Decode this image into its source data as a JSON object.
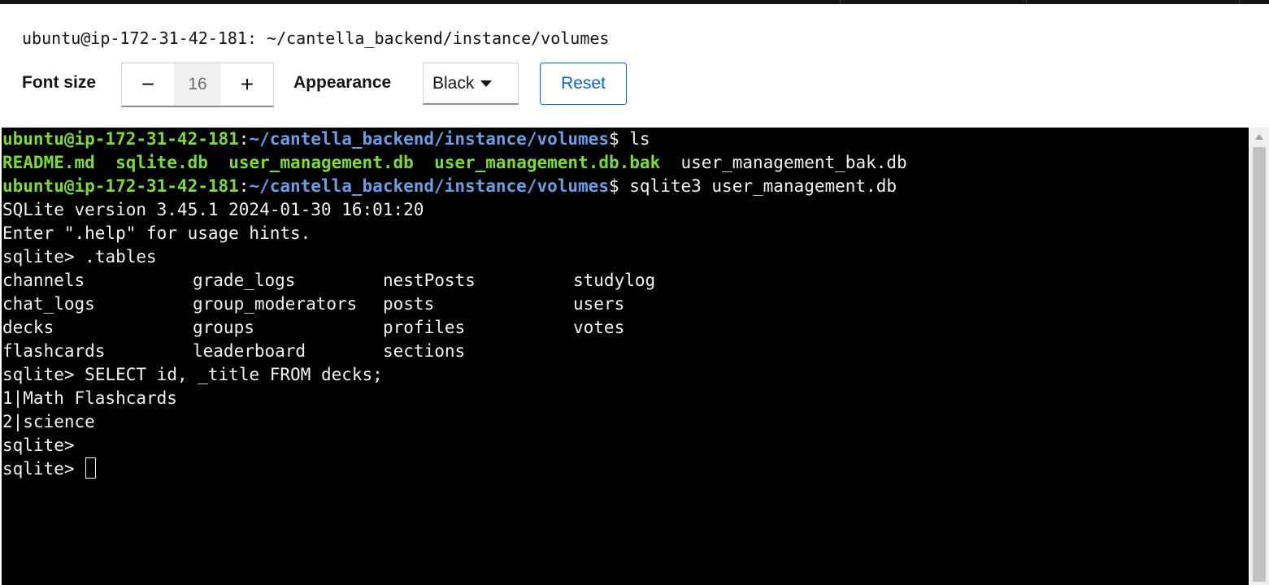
{
  "window": {
    "title": "ubuntu@ip-172-31-42-181: ~/cantella_backend/instance/volumes"
  },
  "toolbar": {
    "font_size_label": "Font size",
    "decrease": "−",
    "font_size_value": "16",
    "increase": "+",
    "appearance_label": "Appearance",
    "appearance_value": "Black",
    "reset_label": "Reset"
  },
  "colors": {
    "prompt_user": "#7ddc34",
    "prompt_path": "#6b9ee6",
    "terminal_bg": "#000000",
    "accent": "#0066cc"
  },
  "terminal": {
    "prompt_user": "ubuntu@ip-172-31-42-181",
    "prompt_path": "~/cantella_backend/instance/volumes",
    "cmd_ls": "ls",
    "ls_files_colored": [
      "README.md",
      "sqlite.db",
      "user_management.db",
      "user_management.db.bak"
    ],
    "ls_file_plain": "user_management_bak.db",
    "cmd_sqlite": "sqlite3 user_management.db",
    "version_line": "SQLite version 3.45.1 2024-01-30 16:01:20",
    "help_line": "Enter \".help\" for usage hints.",
    "sqlite_prompt": "sqlite>",
    "cmd_tables": ".tables",
    "tables": [
      [
        "channels",
        "grade_logs",
        "nestPosts",
        "studylog"
      ],
      [
        "chat_logs",
        "group_moderators",
        "posts",
        "users"
      ],
      [
        "decks",
        "groups",
        "profiles",
        "votes"
      ],
      [
        "flashcards",
        "leaderboard",
        "sections",
        ""
      ]
    ],
    "cmd_select": "SELECT id, _title FROM decks;",
    "results": [
      "1|Math Flashcards",
      "2|science"
    ]
  }
}
